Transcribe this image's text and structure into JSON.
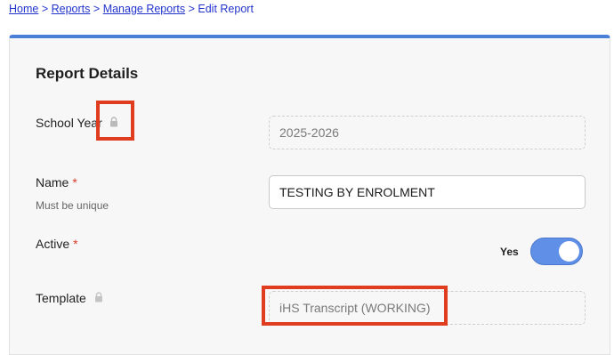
{
  "breadcrumb": {
    "home": "Home",
    "sep1": ">",
    "reports": "Reports",
    "sep2": ">",
    "manage_reports": "Manage Reports",
    "sep3": ">",
    "current": "Edit Report"
  },
  "card": {
    "title": "Report Details",
    "accent_color": "#4a7fd8"
  },
  "fields": {
    "school_year": {
      "label": "School Year",
      "value": "2025-2026",
      "locked": true
    },
    "name": {
      "label": "Name",
      "required_mark": "*",
      "help": "Must be unique",
      "value": "TESTING BY ENROLMENT"
    },
    "active": {
      "label": "Active",
      "required_mark": "*",
      "toggle_label": "Yes",
      "value": true
    },
    "template": {
      "label": "Template",
      "value": "iHS Transcript (WORKING)",
      "locked": true
    }
  },
  "icons": {
    "lock": "lock-icon"
  },
  "annotation_color": "#e03c1f"
}
